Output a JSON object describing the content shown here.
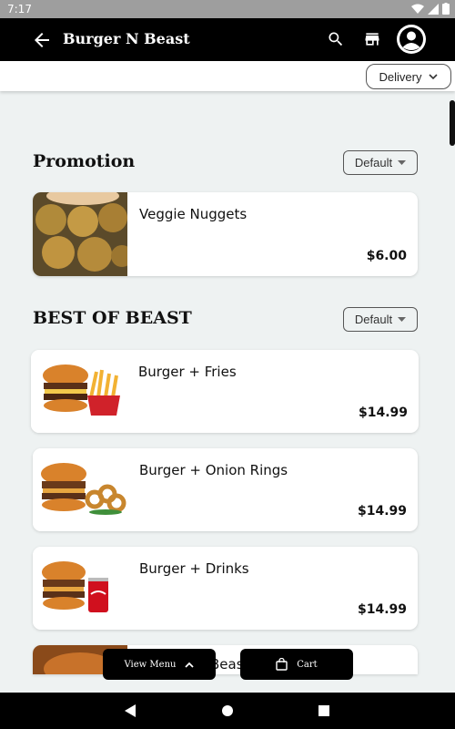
{
  "status_bar": {
    "time": "7:17"
  },
  "app_bar": {
    "title": "Burger N Beast",
    "icons": [
      "back-arrow-icon",
      "search-icon",
      "store-icon",
      "account-icon"
    ]
  },
  "order_mode": {
    "selected": "Delivery"
  },
  "sections": [
    {
      "title": "Promotion",
      "sort_label": "Default",
      "items": [
        {
          "name": "Veggie Nuggets",
          "price": "$6.00"
        }
      ]
    },
    {
      "title": "BEST OF BEAST",
      "sort_label": "Default",
      "items": [
        {
          "name": "Burger + Fries",
          "price": "$14.99"
        },
        {
          "name": "Burger + Onion Rings",
          "price": "$14.99"
        },
        {
          "name": "Burger + Drinks",
          "price": "$14.99"
        },
        {
          "name": "Beas",
          "price": ""
        }
      ]
    }
  ],
  "floating": {
    "view_menu": "View Menu",
    "cart": "Cart"
  },
  "colors": {
    "bar": "#000000",
    "background": "#eef2f2",
    "card": "#ffffff"
  }
}
